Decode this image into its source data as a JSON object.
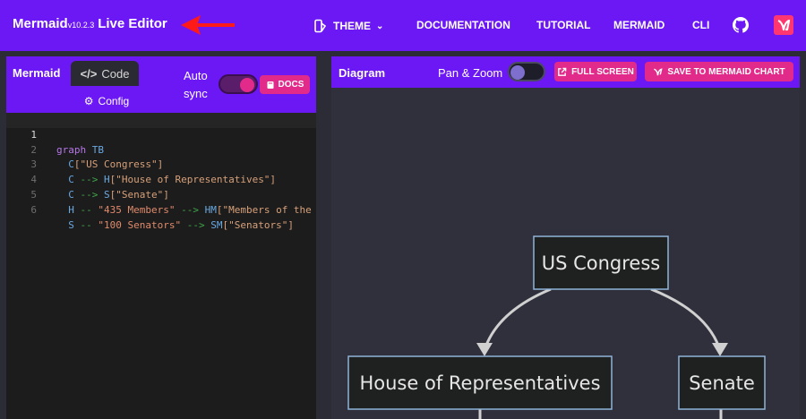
{
  "app": {
    "brand_name": "Mermaid",
    "version": "v10.2.3",
    "brand_suffix": "Live Editor"
  },
  "nav": {
    "theme": "THEME",
    "documentation": "DOCUMENTATION",
    "tutorial": "TUTORIAL",
    "mermaid": "MERMAID",
    "cli": "CLI"
  },
  "editor": {
    "title": "Mermaid",
    "tab_code": "Code",
    "tab_config": "Config",
    "auto_sync_line1": "Auto",
    "auto_sync_line2": "sync",
    "auto_sync_on": true,
    "docs_label": "DOCS",
    "lines": [
      {
        "n": "1",
        "text": "graph TB"
      },
      {
        "n": "2",
        "text": "  C[\"US Congress\"]"
      },
      {
        "n": "3",
        "text": "  C --> H[\"House of Representatives\"]"
      },
      {
        "n": "4",
        "text": "  C --> S[\"Senate\"]"
      },
      {
        "n": "5",
        "text": "  H -- \"435 Members\" --> HM[\"Members of the"
      },
      {
        "n": "6",
        "text": "  S -- \"100 Senators\" --> SM[\"Senators\"]"
      }
    ]
  },
  "diagram_panel": {
    "title": "Diagram",
    "pan_zoom": "Pan & Zoom",
    "pan_zoom_on": false,
    "full_screen": "FULL SCREEN",
    "save": "SAVE TO MERMAID CHART"
  },
  "diagram": {
    "nodes": {
      "congress": "US Congress",
      "house": "House of Representatives",
      "senate": "Senate"
    }
  },
  "colors": {
    "accent": "#6b18f5",
    "pink": "#e22a8a",
    "annotation_arrow": "#ff1a1a",
    "node_border": "#8fb4d9"
  }
}
